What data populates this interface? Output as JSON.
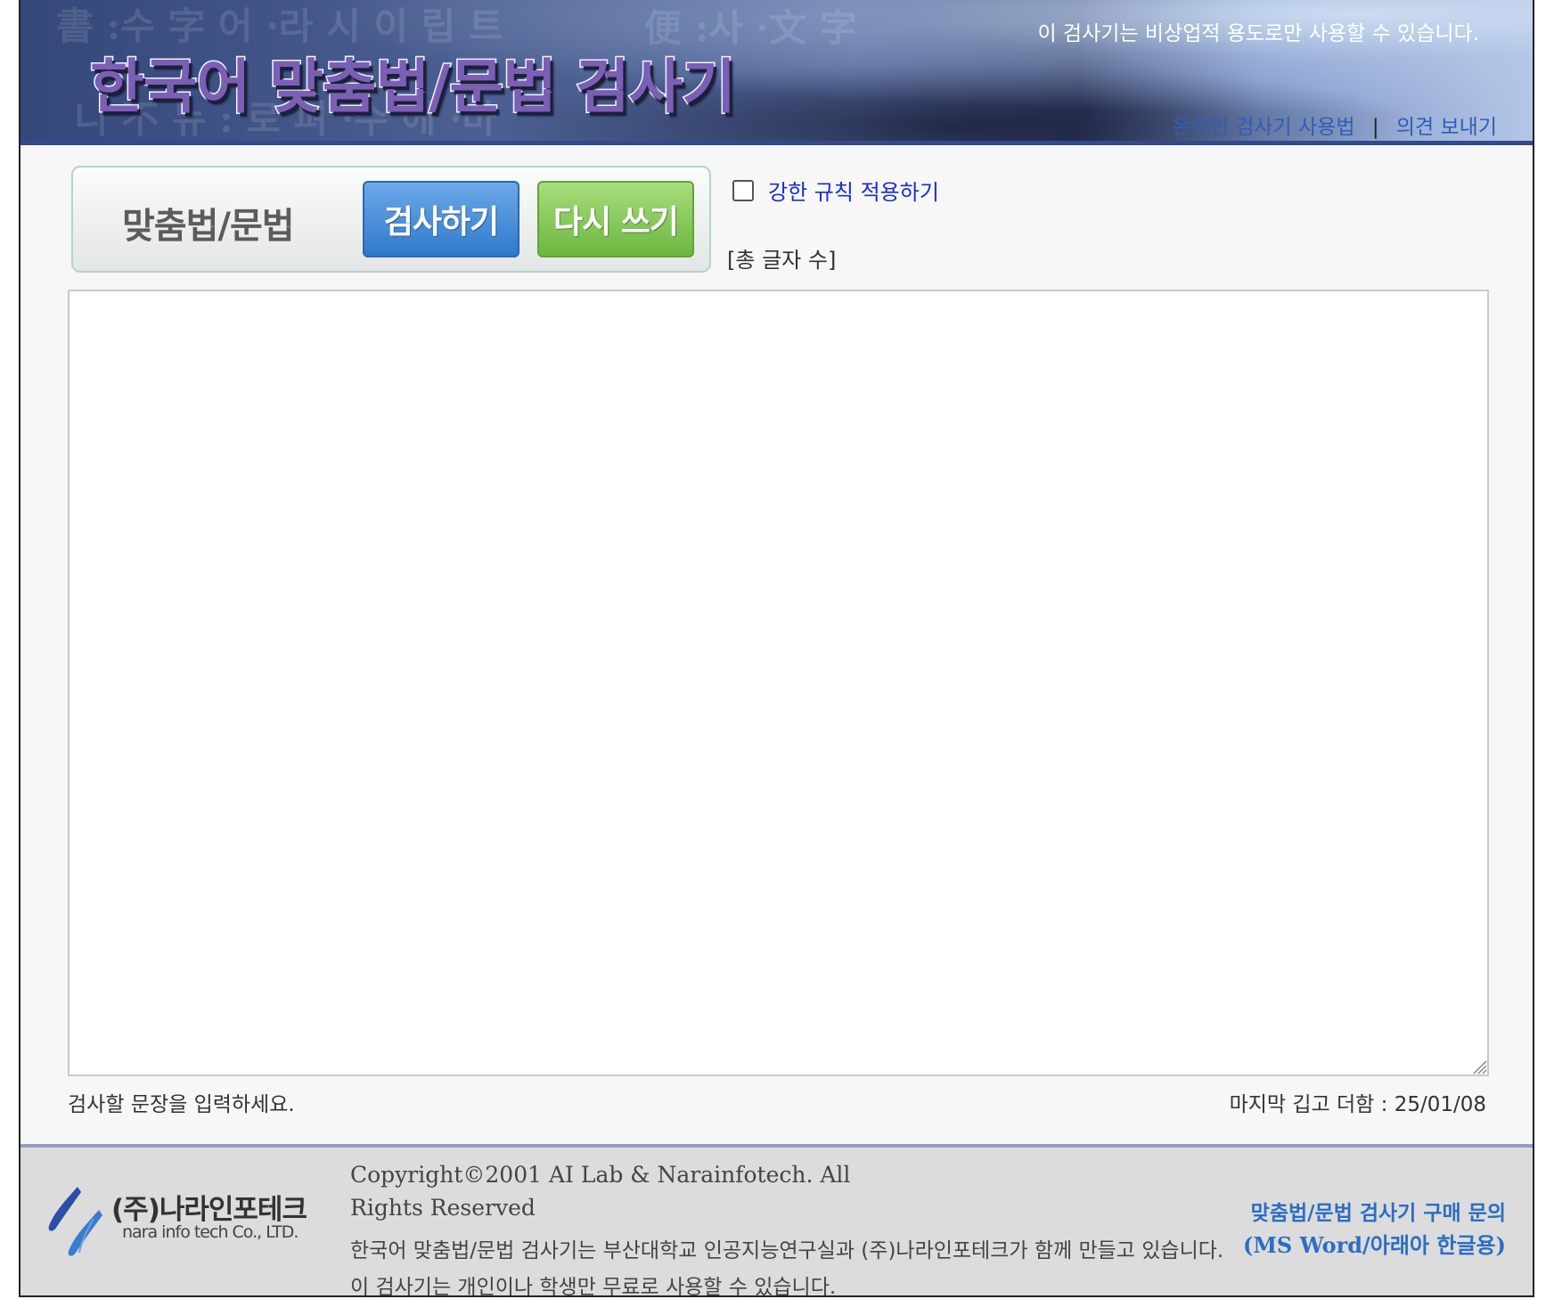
{
  "header": {
    "title": "한국어 맞춤법/문법 검사기",
    "notice": "이 검사기는 비상업적 용도로만 사용할 수 있습니다.",
    "links": [
      "온라인 검사기 사용법",
      "의견 보내기"
    ],
    "link_separator": "|"
  },
  "controls": {
    "mode_label": "맞춤법/문법",
    "check_button": "검사하기",
    "reset_button": "다시 쓰기",
    "strict_rule_label": "강한 규칙 적용하기",
    "strict_rule_checked": false,
    "char_count_label": "[총 글자 수]"
  },
  "editor": {
    "value": "",
    "hint": "검사할 문장을 입력하세요.",
    "last_update": "마지막 깁고 더함 : 25/01/08"
  },
  "footer": {
    "logo_name": "(주)나라인포테크",
    "logo_english": "nara info tech Co., LTD.",
    "copyright": "Copyright©2001 AI Lab & Narainfotech. All Rights Reserved",
    "line1": "한국어 맞춤법/문법 검사기는 부산대학교 인공지능연구실과 (주)나라인포테크가 함께 만들고 있습니다.",
    "line2": "이 검사기는 개인이나 학생만 무료로 사용할 수 있습니다.",
    "purchase_title": "맞춤법/문법 검사기 구매 문의",
    "purchase_sub": "(MS Word/아래아 한글용)"
  },
  "colors": {
    "header_rule": "#354a8a",
    "link_blue": "#2f5db7",
    "check_button": "#2f79cc",
    "reset_button": "#6cb73f",
    "strict_label": "#1a2dd0",
    "footer_bg": "#dcdcdc"
  }
}
